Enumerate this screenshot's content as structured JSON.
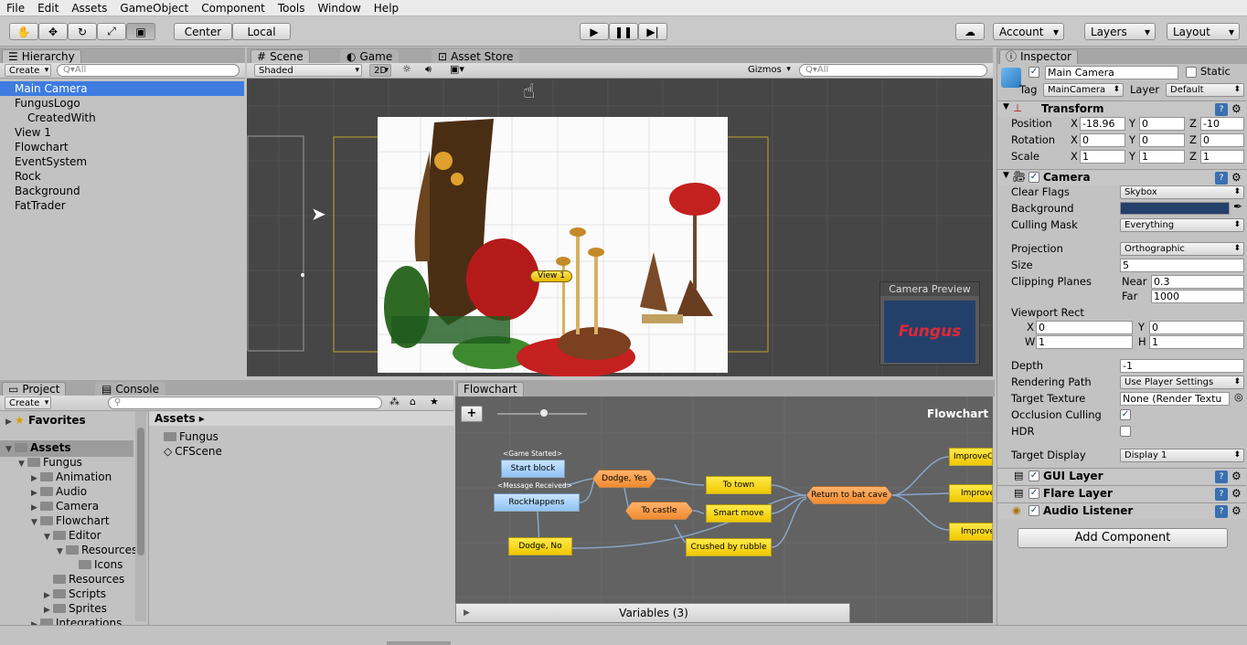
{
  "menu": [
    "File",
    "Edit",
    "Assets",
    "GameObject",
    "Component",
    "Tools",
    "Window",
    "Help"
  ],
  "toolbar": {
    "center": "Center",
    "local": "Local",
    "account": "Account",
    "layers": "Layers",
    "layout": "Layout"
  },
  "hierarchy": {
    "tab": "Hierarchy",
    "create": "Create",
    "search": "Q▾All",
    "items": [
      "Main Camera",
      "FungusLogo",
      "CreatedWith",
      "View 1",
      "Flowchart",
      "EventSystem",
      "Rock",
      "Background",
      "FatTrader"
    ]
  },
  "scene": {
    "tabs": [
      "Scene",
      "Game",
      "Asset Store"
    ],
    "shading": "Shaded",
    "mode2d": "2D",
    "gizmos": "Gizmos",
    "search": "Q▾All",
    "view_label": "View 1",
    "camera_preview": "Camera Preview",
    "preview_logo": "Fungus"
  },
  "project": {
    "tabs": [
      "Project",
      "Console"
    ],
    "create": "Create",
    "favorites": "Favorites",
    "assets": "Assets",
    "breadcrumb": "Assets ▸",
    "tree": [
      "Fungus",
      "Animation",
      "Audio",
      "Camera",
      "Flowchart",
      "Editor",
      "Resources",
      "Icons",
      "Resources",
      "Scripts",
      "Sprites",
      "Integrations"
    ],
    "files": [
      "Fungus",
      "CFScene"
    ]
  },
  "flowchart": {
    "tab": "Flowchart",
    "title": "Flowchart",
    "add": "+",
    "variables": "Variables (3)",
    "event1": "<Game Started>",
    "event2": "<Message Received>",
    "nodes": {
      "start": "Start block",
      "rock": "RockHappens",
      "dodge_yes": "Dodge, Yes",
      "dodge_no": "Dodge, No",
      "to_castle": "To castle",
      "to_town": "To town",
      "smart": "Smart move",
      "crushed": "Crushed by rubble",
      "return": "Return to bat cave",
      "imp1": "ImproveC",
      "imp2": "Improve",
      "imp3": "ImproveF"
    }
  },
  "inspector": {
    "tab": "Inspector",
    "name": "Main Camera",
    "static": "Static",
    "tag_label": "Tag",
    "tag": "MainCamera",
    "layer_label": "Layer",
    "layer": "Default",
    "transform": {
      "title": "Transform",
      "position": "Position",
      "rotation": "Rotation",
      "scale": "Scale",
      "px": "-18.96",
      "py": "0",
      "pz": "-10",
      "rx": "0",
      "ry": "0",
      "rz": "0",
      "sx": "1",
      "sy": "1",
      "sz": "1",
      "x": "X",
      "y": "Y",
      "z": "Z"
    },
    "camera": {
      "title": "Camera",
      "clear_flags": "Clear Flags",
      "clear_flags_val": "Skybox",
      "background": "Background",
      "culling_mask": "Culling Mask",
      "culling_val": "Everything",
      "projection": "Projection",
      "projection_val": "Orthographic",
      "size": "Size",
      "size_val": "5",
      "clipping": "Clipping Planes",
      "near": "Near",
      "near_val": "0.3",
      "far": "Far",
      "far_val": "1000",
      "viewport": "Viewport Rect",
      "vx": "0",
      "vy": "0",
      "vw": "1",
      "vh": "1",
      "x": "X",
      "y": "Y",
      "w": "W",
      "h": "H",
      "depth": "Depth",
      "depth_val": "-1",
      "rendering_path": "Rendering Path",
      "rendering_val": "Use Player Settings",
      "target_texture": "Target Texture",
      "target_texture_val": "None (Render Textu",
      "occlusion": "Occlusion Culling",
      "hdr": "HDR",
      "target_display": "Target Display",
      "target_display_val": "Display 1"
    },
    "components": [
      "GUI Layer",
      "Flare Layer",
      "Audio Listener"
    ],
    "add_component": "Add Component"
  },
  "colors": {
    "selection": "#3e7ce0",
    "camera_bg": "#23406b",
    "node_yellow": "#ffe94a",
    "node_orange": "#f08a2f",
    "node_blue": "#8fc2f4"
  }
}
